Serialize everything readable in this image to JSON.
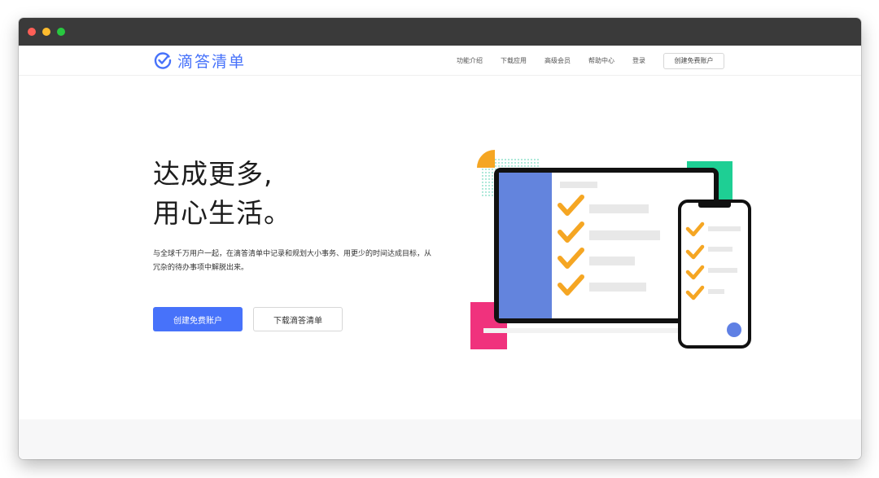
{
  "brand": {
    "name": "滴答清单",
    "accent_color": "#4772fa",
    "logo_icon": "check-circle-icon"
  },
  "nav": {
    "links": [
      "功能介绍",
      "下载应用",
      "高级会员",
      "帮助中心",
      "登录"
    ],
    "cta_label": "创建免费账户"
  },
  "hero": {
    "title_line1": "达成更多,",
    "title_line2": "用心生活。",
    "subtitle_line1": "与全球千万用户一起，在滴答清单中记录和规划大小事务、用更少的时间达成目标，从",
    "subtitle_line2": "冗杂的待办事项中解脱出来。",
    "primary_button": "创建免费账户",
    "secondary_button": "下载滴答清单"
  },
  "illustration": {
    "colors": {
      "sidebar": "#6384dd",
      "check": "#f5a623",
      "frame": "#111111",
      "pink": "#f0327d",
      "green": "#1ecf94",
      "dot": "#5f80e4",
      "placeholder": "#e8e8e8"
    },
    "checked_rows_laptop": 4,
    "checked_rows_phone": 4
  }
}
